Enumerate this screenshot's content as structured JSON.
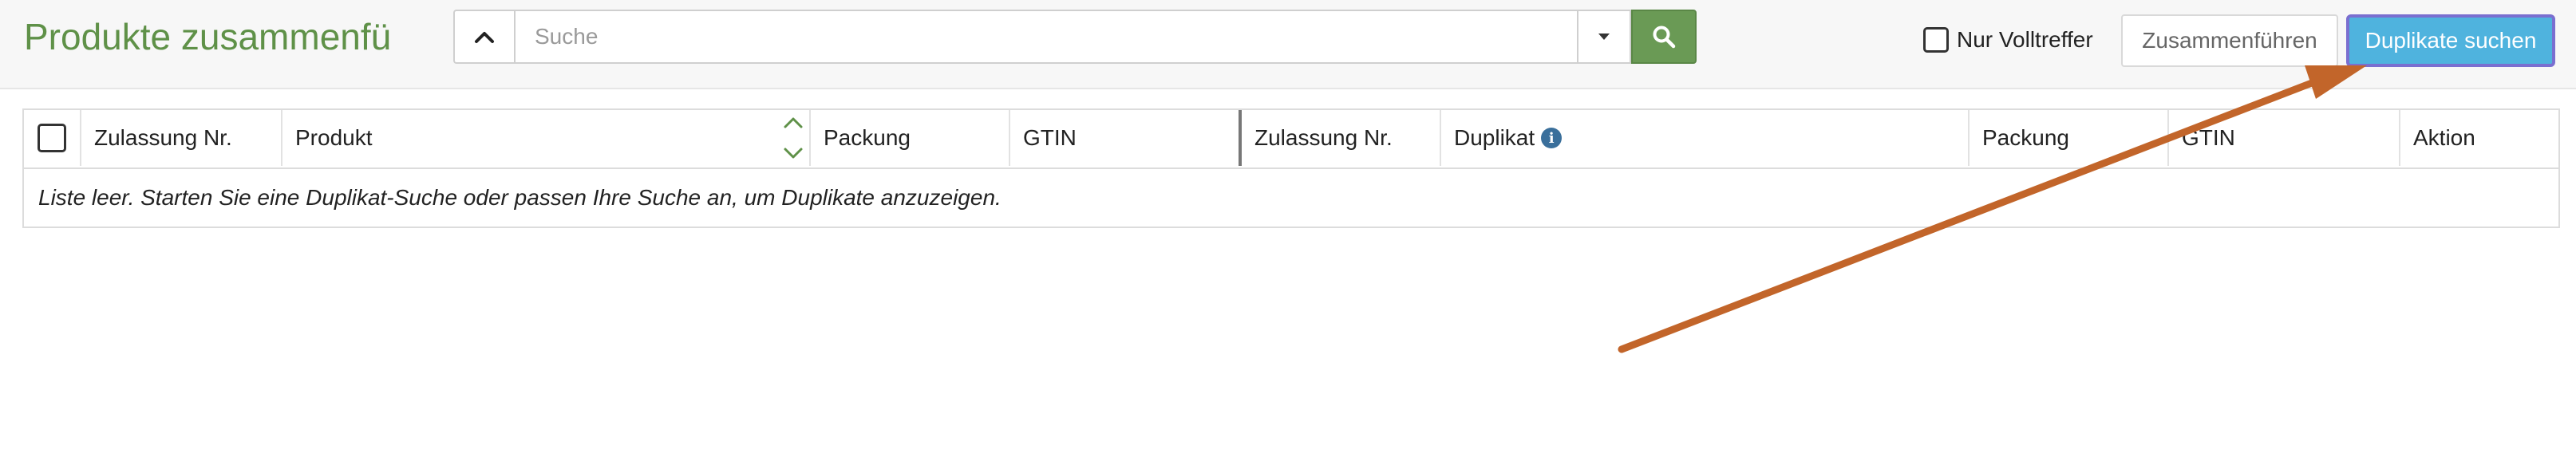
{
  "header": {
    "title": "Produkte zusammenfü",
    "search": {
      "placeholder": "Suche",
      "value": ""
    },
    "only_exact_label": "Nur Volltreffer",
    "merge_label": "Zusammenführen",
    "find_duplicates_label": "Duplikate suchen"
  },
  "table": {
    "columns": [
      "Zulassung Nr.",
      "Produkt",
      "Packung",
      "GTIN",
      "Zulassung Nr.",
      "Duplikat",
      "Packung",
      "GTIN",
      "Aktion"
    ],
    "empty_message": "Liste leer. Starten Sie eine Duplikat-Suche oder passen Ihre Suche an, um Duplikate anzuzeigen."
  },
  "colors": {
    "title_green": "#5f9148",
    "search_button": "#6a9a55",
    "primary_button": "#4fb3de",
    "annotation_arrow": "#c2652a",
    "info_icon": "#3a6f9b"
  },
  "icons": {
    "collapse": "chevron-up-icon",
    "dropdown": "caret-down-icon",
    "search": "search-icon",
    "sort": "sort-icon",
    "info": "info-icon"
  }
}
